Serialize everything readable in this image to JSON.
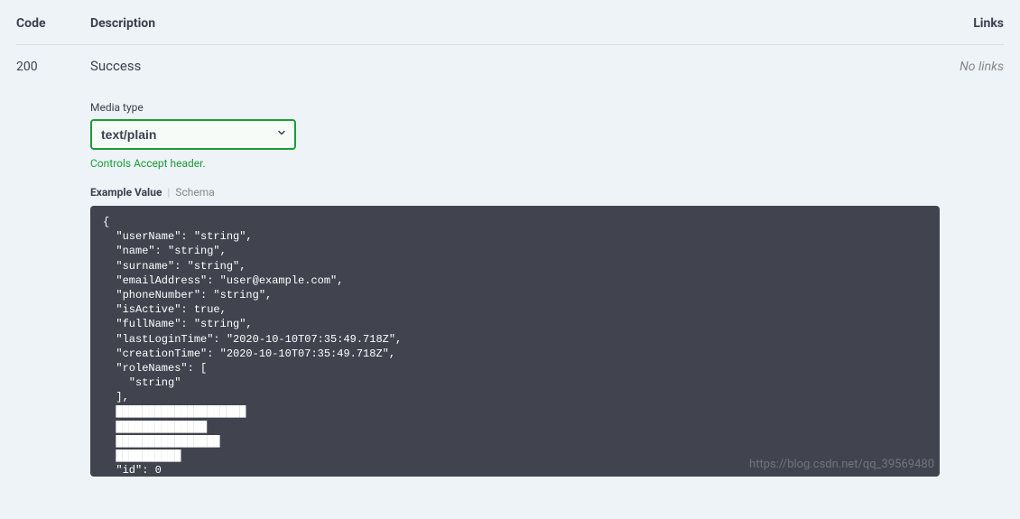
{
  "headers": {
    "code": "Code",
    "description": "Description",
    "links": "Links"
  },
  "response": {
    "code": "200",
    "description": "Success",
    "links": "No links"
  },
  "media": {
    "label": "Media type",
    "selected": "text/plain",
    "hint": "Controls Accept header."
  },
  "tabs": {
    "example": "Example Value",
    "schema": "Schema"
  },
  "example_json": "{\n  \"userName\": \"string\",\n  \"name\": \"string\",\n  \"surname\": \"string\",\n  \"emailAddress\": \"user@example.com\",\n  \"phoneNumber\": \"string\",\n  \"isActive\": true,\n  \"fullName\": \"string\",\n  \"lastLoginTime\": \"2020-10-10T07:35:49.718Z\",\n  \"creationTime\": \"2020-10-10T07:35:49.718Z\",\n  \"roleNames\": [\n    \"string\"\n  ],\n  ████████████████████\n  ██████████████\n  ████████████████\n  ██████████\n  \"id\": 0\n}",
  "watermark": "https://blog.csdn.net/qq_39569480"
}
